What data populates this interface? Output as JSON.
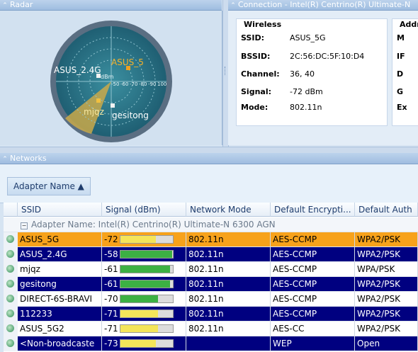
{
  "panes": {
    "radar_title": "Radar",
    "connection_title": "Connection - Intel(R) Centrino(R) Ultimate-N",
    "networks_title": "Networks"
  },
  "radar": {
    "unit": "dBm",
    "scale_labels": [
      "-50",
      "-60",
      "-70",
      "-80",
      "-90",
      "100"
    ],
    "networks": [
      "ASUS_2.4G",
      "ASUS_5",
      "mjqz",
      "gesitong"
    ]
  },
  "connection": {
    "wireless_title": "Wireless",
    "address_title": "Addr",
    "address_labels": [
      "M",
      "IF",
      "D",
      "G",
      "Ex"
    ],
    "fields": [
      {
        "label": "SSID:",
        "value": "ASUS_5G"
      },
      {
        "label": "BSSID:",
        "value": "2C:56:DC:5F:10:D4"
      },
      {
        "label": "Channel:",
        "value": "36, 40"
      },
      {
        "label": "Signal:",
        "value": "-72 dBm"
      },
      {
        "label": "Mode:",
        "value": "802.11n"
      }
    ]
  },
  "grid": {
    "group_chip": "Adapter Name ▲",
    "columns": [
      "SSID",
      "Signal (dBm)",
      "Network Mode",
      "Default Encrypti...",
      "Default Auth"
    ],
    "group_row": "Adapter Name: Intel(R) Centrino(R) Ultimate-N 6300 AGN",
    "rows": [
      {
        "ssid": "ASUS_5G",
        "signal": "-72",
        "level": 0.68,
        "mode": "802.11n",
        "enc": "AES-CCMP",
        "auth": "WPA2/PSK",
        "style": "orange",
        "bar_color": "#f4e55a"
      },
      {
        "ssid": "ASUS_2.4G",
        "signal": "-58",
        "level": 0.98,
        "mode": "802.11n",
        "enc": "AES-CCMP",
        "auth": "WPA2/PSK",
        "style": "navy",
        "bar_color": "#3cb043"
      },
      {
        "ssid": "mjqz",
        "signal": "-61",
        "level": 0.95,
        "mode": "802.11n",
        "enc": "AES-CCMP",
        "auth": "WPA/PSK",
        "style": "white",
        "bar_color": "#3cb043"
      },
      {
        "ssid": "gesitong",
        "signal": "-61",
        "level": 0.95,
        "mode": "802.11n",
        "enc": "AES-CCMP",
        "auth": "WPA2/PSK",
        "style": "navy",
        "bar_color": "#3cb043"
      },
      {
        "ssid": "DIRECT-6S-BRAVI",
        "signal": "-70",
        "level": 0.72,
        "mode": "802.11n",
        "enc": "AES-CCMP",
        "auth": "WPA2/PSK",
        "style": "white",
        "bar_color": "#3cb043"
      },
      {
        "ssid": "112233",
        "signal": "-71",
        "level": 0.72,
        "mode": "802.11n",
        "enc": "AES-CCMP",
        "auth": "WPA2/PSK",
        "style": "navy",
        "bar_color": "#f4e55a"
      },
      {
        "ssid": "ASUS_5G2",
        "signal": "-71",
        "level": 0.72,
        "mode": "802.11n",
        "enc": "AES-CC",
        "auth": "WPA2/PSK",
        "style": "white",
        "bar_color": "#f4e55a"
      },
      {
        "ssid": "<Non-broadcaste",
        "signal": "-73",
        "level": 0.68,
        "mode": "",
        "enc": "WEP",
        "auth": "Open",
        "style": "navy",
        "bar_color": "#f4e55a"
      }
    ]
  }
}
